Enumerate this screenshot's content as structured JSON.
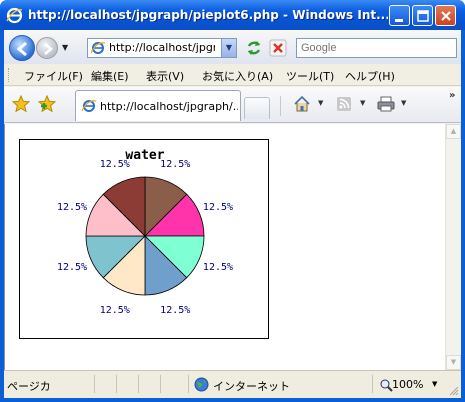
{
  "window": {
    "title": "http://localhost/jpgraph/pieplot6.php - Windows Int..."
  },
  "address_bar": {
    "url": "http://localhost/jpgr",
    "search_placeholder": "Google"
  },
  "menu": {
    "items": [
      "ファイル(F)",
      "編集(E)",
      "表示(V)",
      "お気に入り(A)",
      "ツール(T)",
      "ヘルプ(H)"
    ]
  },
  "tabs": {
    "active_label": "http://localhost/jpgraph/..."
  },
  "status_bar": {
    "text": "ページカ",
    "zone": "インターネット",
    "zoom": "100%"
  },
  "icons": {
    "ie": "ie-logo-icon",
    "favorites": "favorites-star-icon",
    "add_favorite": "add-favorite-icon",
    "home": "home-icon",
    "feeds": "feeds-icon",
    "print": "print-icon",
    "refresh": "refresh-icon",
    "stop": "stop-icon",
    "globe": "internet-globe-icon",
    "zoom": "zoom-icon"
  },
  "chart_data": {
    "type": "pie",
    "title": "water",
    "slices": [
      {
        "value": 12.5,
        "label": "12.5%",
        "color": "#8b5e4a"
      },
      {
        "value": 12.5,
        "label": "12.5%",
        "color": "#ff33aa"
      },
      {
        "value": 12.5,
        "label": "12.5%",
        "color": "#7fffd4"
      },
      {
        "value": 12.5,
        "label": "12.5%",
        "color": "#6f9fcb"
      },
      {
        "value": 12.5,
        "label": "12.5%",
        "color": "#ffe8c8"
      },
      {
        "value": 12.5,
        "label": "12.5%",
        "color": "#7fc3cf"
      },
      {
        "value": 12.5,
        "label": "12.5%",
        "color": "#ffbfca"
      },
      {
        "value": 12.5,
        "label": "12.5%",
        "color": "#8c3c34"
      }
    ]
  }
}
